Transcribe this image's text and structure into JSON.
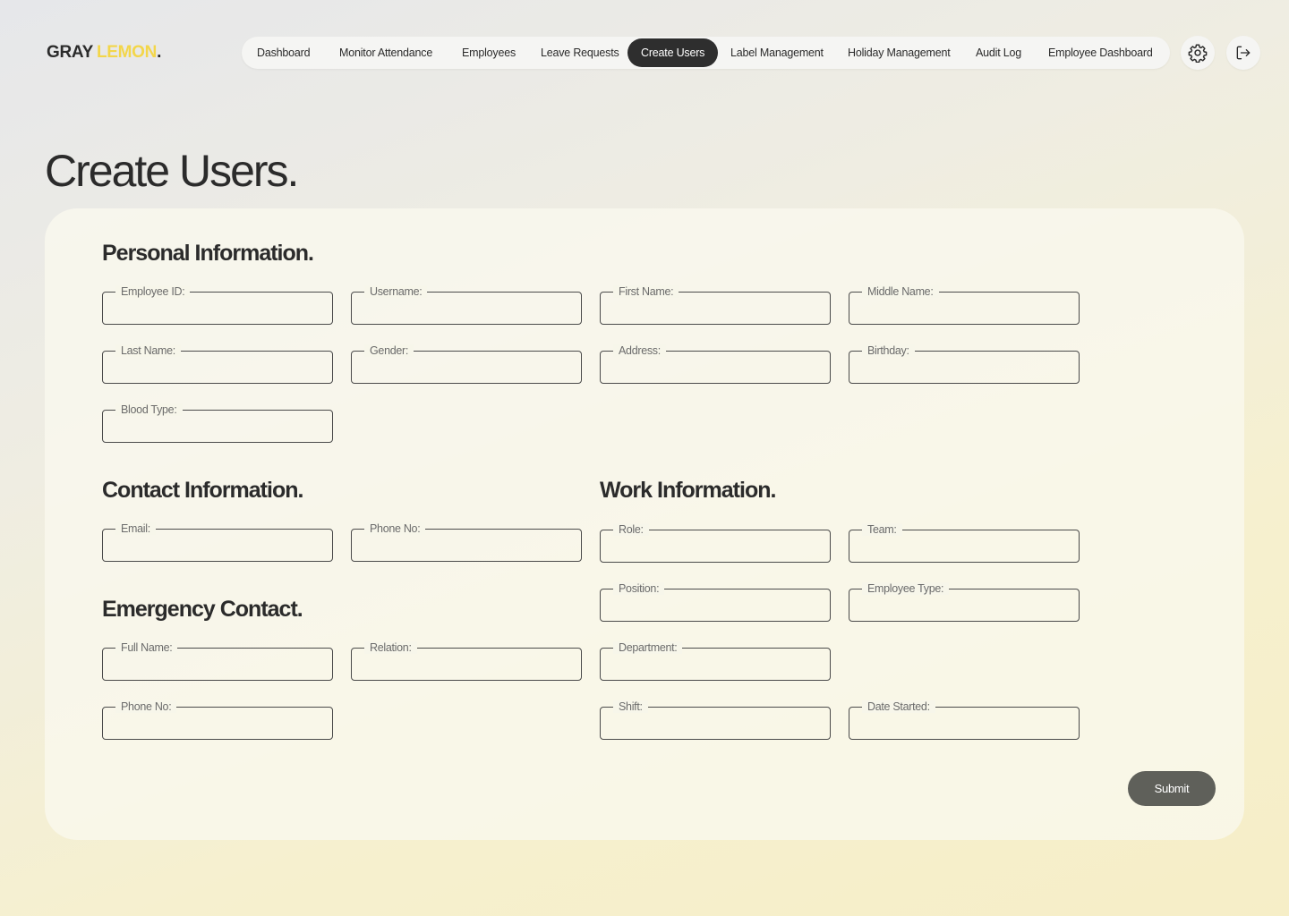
{
  "brand": {
    "part1": "GRAY",
    "part2": "LEMON",
    "dot": "."
  },
  "nav": {
    "items": [
      {
        "label": "Dashboard",
        "active": false
      },
      {
        "label": "Monitor Attendance",
        "active": false
      },
      {
        "label": "Employees",
        "active": false
      },
      {
        "label": "Leave Requests",
        "active": false
      },
      {
        "label": "Create Users",
        "active": true
      },
      {
        "label": "Label Management",
        "active": false
      },
      {
        "label": "Holiday Management",
        "active": false
      },
      {
        "label": "Audit Log",
        "active": false
      },
      {
        "label": "Employee Dashboard",
        "active": false
      }
    ],
    "settings_icon": "gear-icon",
    "logout_icon": "logout-icon"
  },
  "page": {
    "title": "Create Users."
  },
  "sections": {
    "personal": {
      "title": "Personal Information.",
      "fields": [
        "Employee ID:",
        "Username:",
        "First Name:",
        "Middle Name:",
        "Last Name:",
        "Gender:",
        "Address:",
        "Birthday:",
        "Blood Type:"
      ]
    },
    "contact": {
      "title": "Contact Information.",
      "fields": [
        "Email:",
        "Phone No:"
      ]
    },
    "emergency": {
      "title": "Emergency Contact.",
      "fields": [
        "Full Name:",
        "Relation:",
        "Phone No:"
      ]
    },
    "work": {
      "title": "Work Information.",
      "fields": [
        "Role:",
        "Team:",
        "Position:",
        "Employee Type:",
        "Department:",
        "Shift:",
        "Date Started:"
      ]
    }
  },
  "submit": {
    "label": "Submit"
  },
  "colors": {
    "accent_yellow": "#f3d64a",
    "dark": "#2e2e2e",
    "submit_bg": "#5f605a"
  }
}
